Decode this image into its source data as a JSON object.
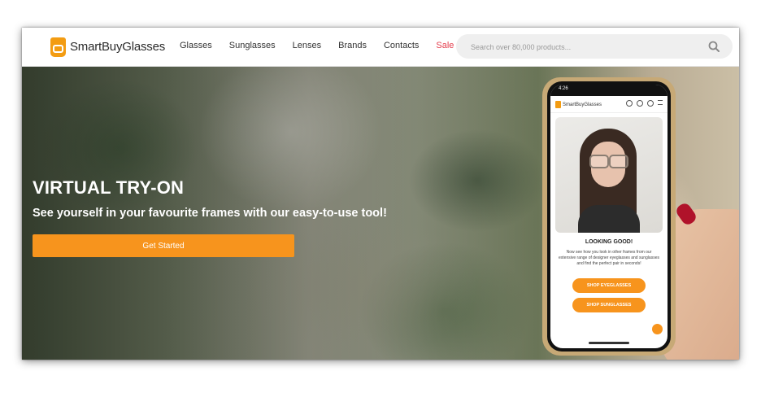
{
  "header": {
    "logo_text": "SmartBuyGlasses",
    "nav": [
      {
        "label": "Glasses"
      },
      {
        "label": "Sunglasses"
      },
      {
        "label": "Lenses"
      },
      {
        "label": "Brands"
      },
      {
        "label": "Contacts"
      },
      {
        "label": "Sale"
      }
    ],
    "search": {
      "placeholder": "Search over 80,000 products..."
    }
  },
  "hero": {
    "title": "VIRTUAL TRY-ON",
    "subtitle": "See yourself in your favourite frames with our easy-to-use tool!",
    "cta_label": "Get Started"
  },
  "phone": {
    "time": "4:26",
    "logo_text": "SmartBuyGlasses",
    "title": "LOOKING GOOD!",
    "description": "Now see how you look in other frames from our extensive range of designer eyeglasses and sunglasses and find the perfect pair in seconds!",
    "button_eyeglasses": "SHOP EYEGLASSES",
    "button_sunglasses": "SHOP SUNGLASSES"
  },
  "colors": {
    "accent": "#f7941d",
    "sale": "#e4404f",
    "nail": "#b0122a"
  },
  "icons": {
    "search": "search-icon",
    "logo": "logo-icon"
  }
}
